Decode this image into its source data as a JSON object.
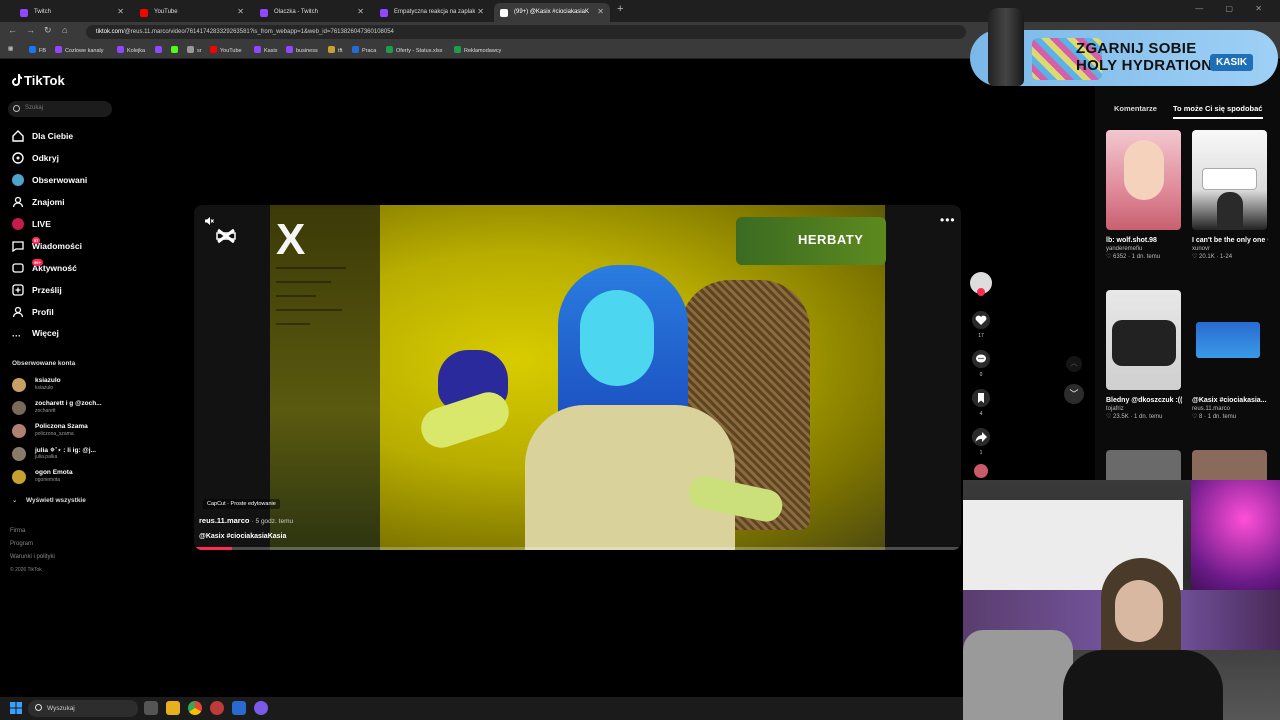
{
  "browser": {
    "tabs": [
      {
        "label": "Twitch",
        "color": "#9146ff"
      },
      {
        "label": "YouTube",
        "color": "#ff0000"
      },
      {
        "label": "Olaczka - Twitch",
        "color": "#9146ff"
      },
      {
        "label": "Empatyczna reakcja na zaplak",
        "color": "#9146ff"
      },
      {
        "label": "(99+) @Kasix #ciociakasiaK",
        "color": "#ffffff"
      }
    ],
    "url_domain": "tiktok.com",
    "url_rest": "/@reus.11.marco/video/7614174283329263581?is_from_webapp=1&web_id=7613826047360108054",
    "bookmarks": [
      "FB",
      "Cozlowe kanaly",
      "Kolejka",
      "",
      "",
      "sr",
      "YouTube",
      "Kasix",
      "business",
      "tft",
      "Praca",
      "Oferty - Status.xlsx",
      "Reklamodawcy"
    ]
  },
  "tiktok": {
    "logo": "TikTok",
    "search_placeholder": "Szukaj",
    "nav": [
      {
        "label": "Dla Ciebie",
        "icon": "home-icon"
      },
      {
        "label": "Odkryj",
        "icon": "compass-icon"
      },
      {
        "label": "Obserwowani",
        "icon": "following-icon"
      },
      {
        "label": "Znajomi",
        "icon": "friends-icon"
      },
      {
        "label": "LIVE",
        "icon": "live-icon"
      },
      {
        "label": "Wiadomości",
        "icon": "messages-icon",
        "badge": "57"
      },
      {
        "label": "Aktywność",
        "icon": "activity-icon",
        "badge": "99+"
      },
      {
        "label": "Prześlij",
        "icon": "upload-icon"
      },
      {
        "label": "Profil",
        "icon": "profile-icon"
      },
      {
        "label": "Więcej",
        "icon": "more-icon"
      }
    ],
    "followed_title": "Obserwowane konta",
    "followed": [
      {
        "name": "ksiazulo",
        "handle": "ksiazulo",
        "color": "#c9a064"
      },
      {
        "name": "zocharett i g @zoch...",
        "handle": "zocharett",
        "color": "#7a6a5a"
      },
      {
        "name": "Policzona Szama",
        "handle": "policzona_szama",
        "color": "#b08070"
      },
      {
        "name": "julia ✵˚⋆ : li ig: @j...",
        "handle": "julia.palka",
        "color": "#8a7a6a"
      },
      {
        "name": "ogon Emota",
        "handle": "ogonemota",
        "color": "#c8a030"
      }
    ],
    "show_all": "Wyświetl wszystkie",
    "footer": [
      "Firma",
      "Program",
      "Warunki i polityki",
      "© 2026 TikTok"
    ]
  },
  "video": {
    "overlay_brand": "HERBATY",
    "big_x": "X",
    "edit_tag": "CapCut · Proste edytowanie",
    "author": "reus.11.marco",
    "posted": "· 5 godz. temu",
    "caption": "@Kasix #ciociakasiaKasia",
    "progress": 0.05
  },
  "actions": [
    {
      "icon": "heart-icon",
      "count": "17"
    },
    {
      "icon": "comment-icon",
      "count": "0"
    },
    {
      "icon": "bookmark-icon",
      "count": "4"
    },
    {
      "icon": "share-icon",
      "count": "1"
    }
  ],
  "right_panel": {
    "tab_comments": "Komentarze",
    "tab_related": "To może Ci się spodobać",
    "cards": [
      {
        "title": "lb: wolf.shot.98",
        "author": "yanderemefiu",
        "stats": "♡ 6352 · 1 dn. temu",
        "bg": "#e8b8c0"
      },
      {
        "title": "I can't be the only one 😢 (reuploa...",
        "author": "xunovr",
        "stats": "♡ 20.1K · 1-24",
        "bg": "#f0f0f0"
      },
      {
        "title": "Bledny @dkoszczuk :(((",
        "author": "tojafriz",
        "stats": "♡ 23.5K · 1 dn. temu",
        "bg": "#d8d8d8"
      },
      {
        "title": "@Kasix #ciociakasia...",
        "author": "reus.11.marco",
        "stats": "♡ 8 · 1 dn. temu",
        "bg": "#1a1a1a"
      }
    ]
  },
  "ad": {
    "line1": "ZGARNIJ SOBIE",
    "line2": "HOLY HYDRATION",
    "brand": "KASIK"
  },
  "taskbar": {
    "search_placeholder": "Wyszukaj"
  },
  "colors": {
    "accent": "#fe2c55",
    "bg": "#000000"
  }
}
